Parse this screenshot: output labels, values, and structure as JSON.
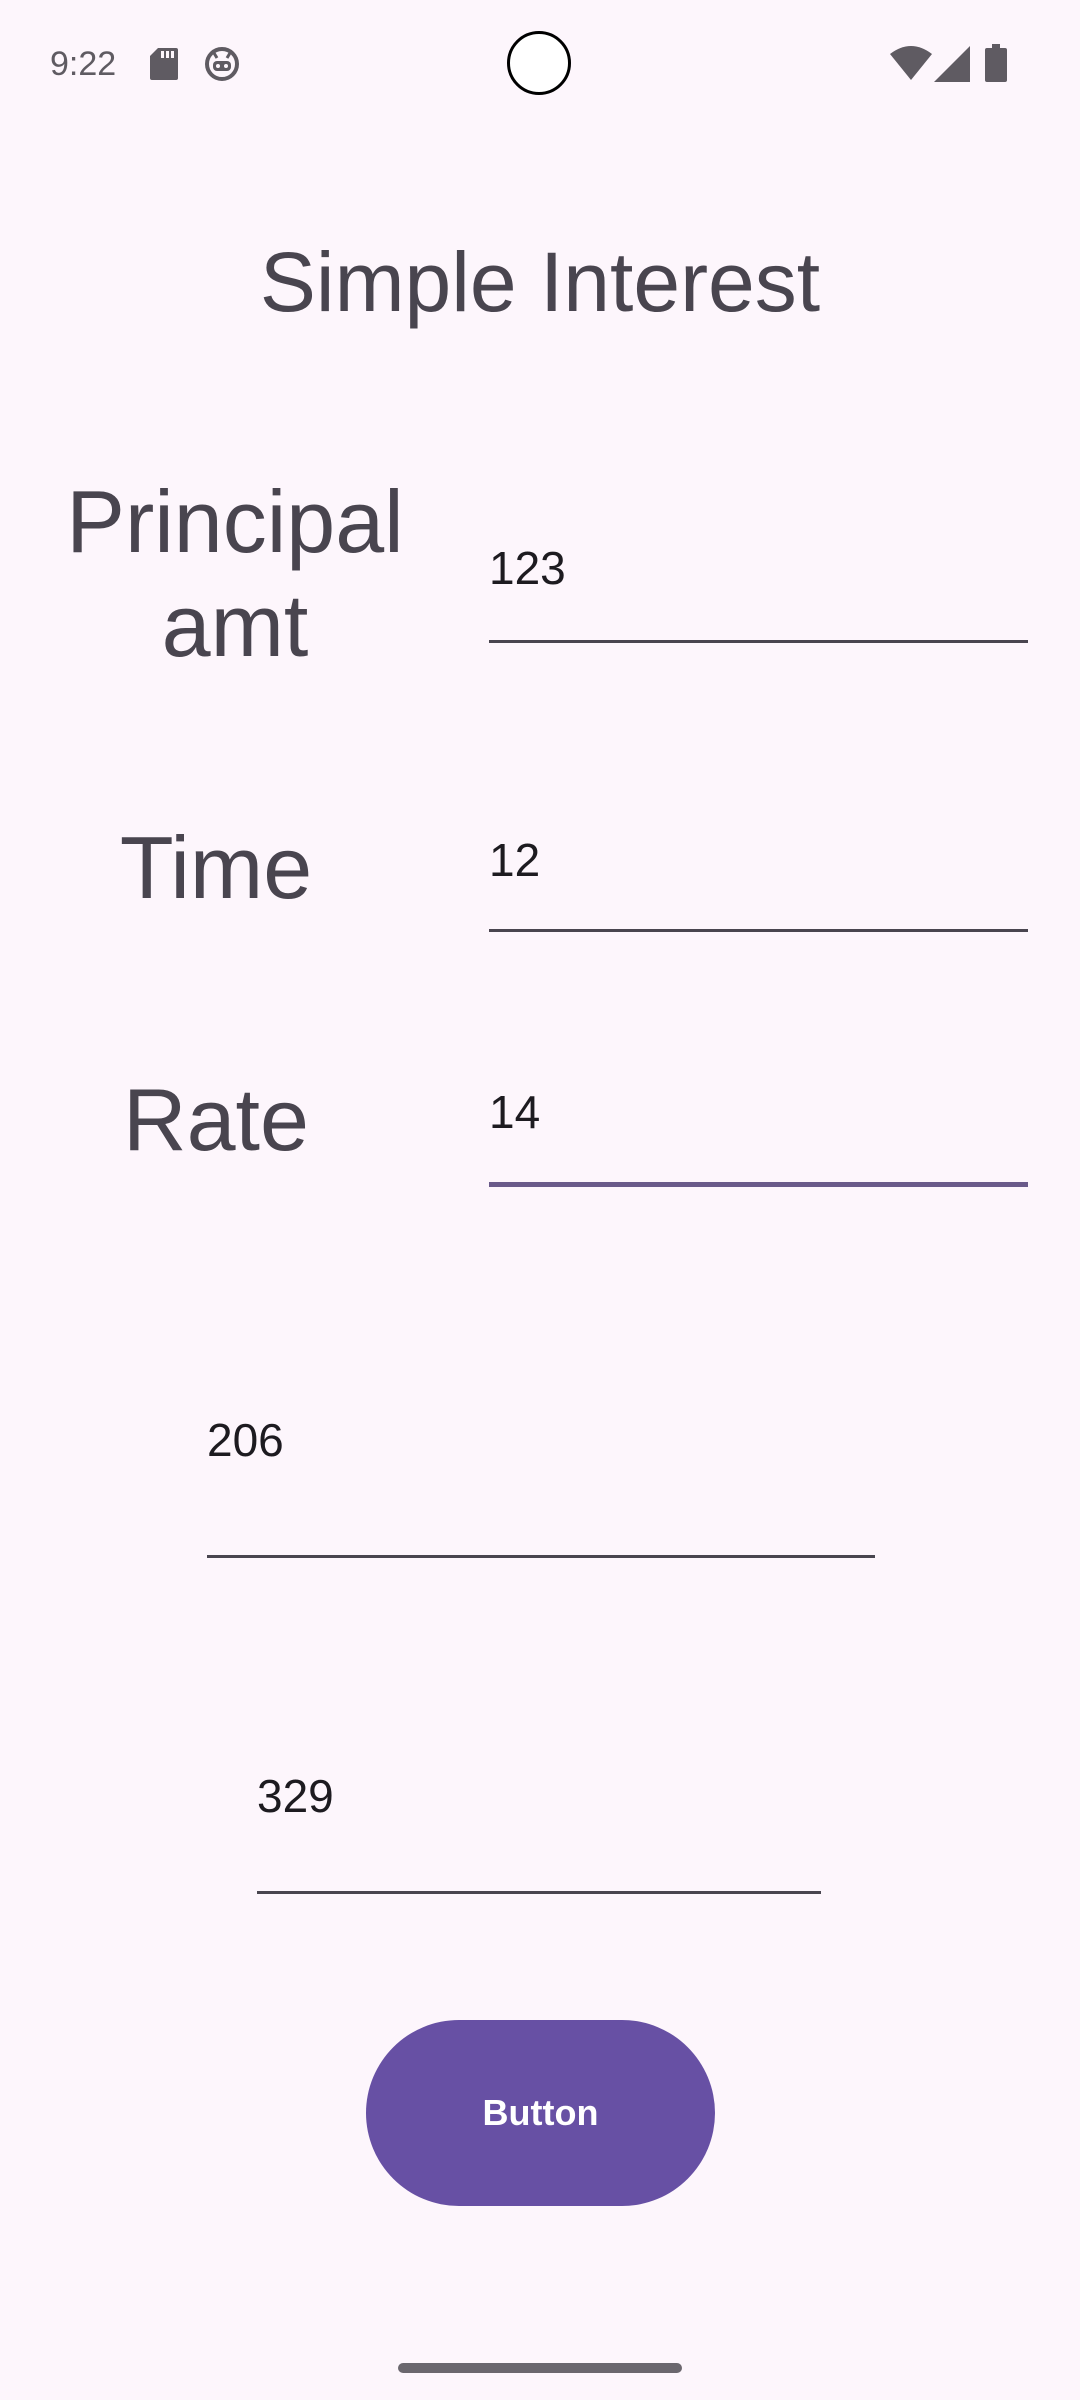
{
  "status_bar": {
    "time": "9:22",
    "icons": [
      "sd-card-icon",
      "android-face-icon",
      "wifi-icon",
      "signal-icon",
      "battery-icon"
    ]
  },
  "title": "Simple Interest",
  "labels": {
    "principal": "Principal amt",
    "time": "Time",
    "rate": "Rate"
  },
  "inputs": {
    "principal": "123",
    "time": "12",
    "rate": "14"
  },
  "outputs": {
    "first": "206",
    "second": "329"
  },
  "button": {
    "label": "Button"
  },
  "colors": {
    "background": "#fdf6fc",
    "button": "#6750a4",
    "text": "#49454f"
  }
}
